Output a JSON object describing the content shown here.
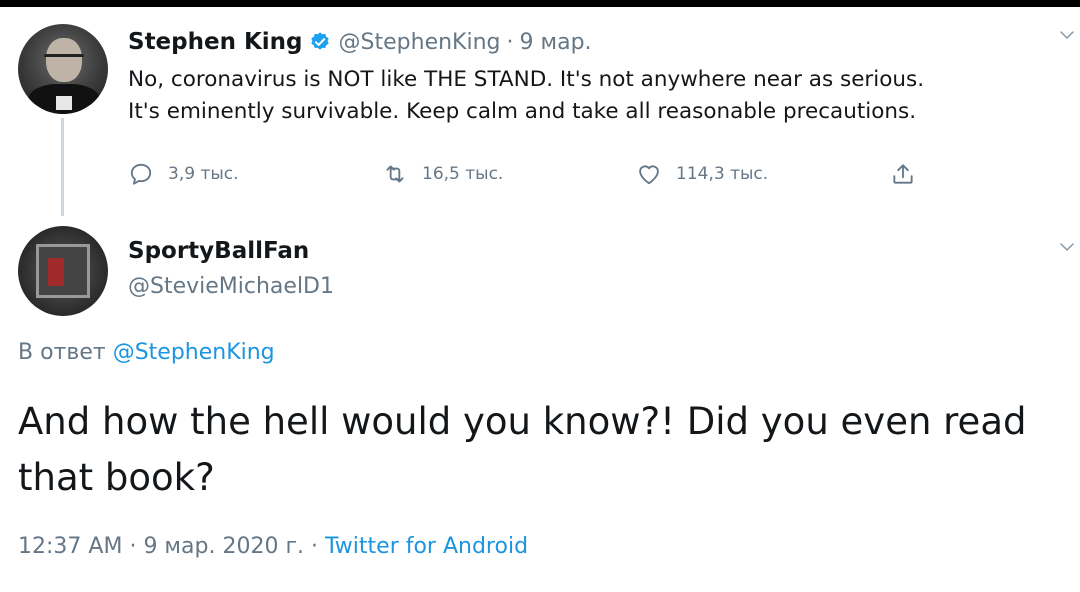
{
  "parent_tweet": {
    "author_name": "Stephen King",
    "handle": "@StephenKing",
    "separator": "·",
    "date": "9 мар.",
    "text_line1": "No, coronavirus is NOT like THE STAND. It's not anywhere near as serious.",
    "text_line2": "It's eminently survivable. Keep calm and take all reasonable precautions.",
    "replies": "3,9 тыс.",
    "retweets": "16,5 тыс.",
    "likes": "114,3 тыс."
  },
  "reply_tweet": {
    "author_name": "SportyBallFan",
    "handle": "@StevieMichaelD1",
    "reply_prefix": "В ответ",
    "reply_mention": "@StephenKing",
    "text_line1": "And how the hell would you know?! Did you even read",
    "text_line2": "that book?",
    "time": "12:37 AM",
    "date": "9 мар. 2020 г.",
    "source": "Twitter for Android",
    "separator": "·"
  },
  "colors": {
    "verified": "#1da1f2",
    "link": "#1b95e0",
    "muted": "#657786",
    "text": "#14171a"
  },
  "icons": [
    "verified-badge-icon",
    "chevron-down-icon",
    "reply-icon",
    "retweet-icon",
    "like-icon",
    "share-icon"
  ]
}
